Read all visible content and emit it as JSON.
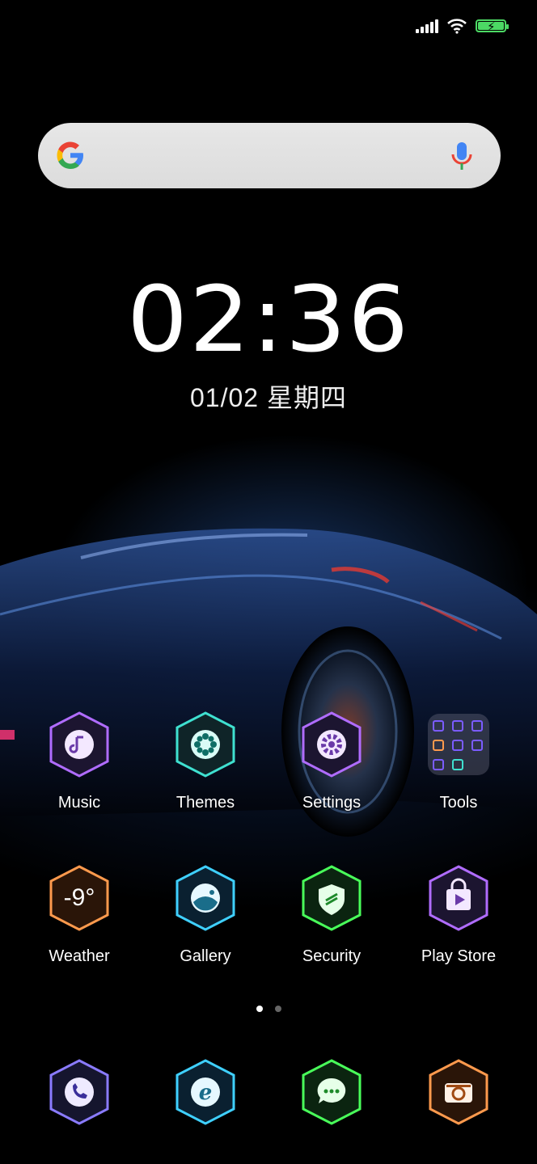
{
  "status_bar": {
    "signal_icon": "signal-bars-icon",
    "wifi_icon": "wifi-icon",
    "battery_icon": "battery-charging-icon",
    "battery_color": "#4cd964"
  },
  "search": {
    "logo_icon": "google-g-icon",
    "mic_icon": "microphone-icon"
  },
  "clock": {
    "time": "02:36",
    "date": "01/02 星期四"
  },
  "apps": [
    {
      "label": "Music",
      "icon": "music-note-icon",
      "accent": "#b06cff"
    },
    {
      "label": "Themes",
      "icon": "flower-icon",
      "accent": "#3fe0d0"
    },
    {
      "label": "Settings",
      "icon": "gear-icon",
      "accent": "#b06cff"
    },
    {
      "label": "Tools",
      "icon": "folder-icon",
      "accent": "#7b5cff"
    },
    {
      "label": "Weather",
      "icon": "weather-temperature-icon",
      "glyph": "-9°",
      "accent": "#ff9a4d"
    },
    {
      "label": "Gallery",
      "icon": "gallery-icon",
      "accent": "#3fd0ff"
    },
    {
      "label": "Security",
      "icon": "shield-icon",
      "accent": "#49ff5a"
    },
    {
      "label": "Play Store",
      "icon": "play-store-icon",
      "accent": "#b06cff"
    }
  ],
  "dock": [
    {
      "icon": "phone-icon",
      "accent": "#8a7bff"
    },
    {
      "icon": "browser-icon",
      "accent": "#3fd0ff"
    },
    {
      "icon": "messages-icon",
      "accent": "#49ff5a"
    },
    {
      "icon": "camera-icon",
      "accent": "#ff9a4d"
    }
  ],
  "page_indicator": {
    "pages": 2,
    "current": 1
  }
}
